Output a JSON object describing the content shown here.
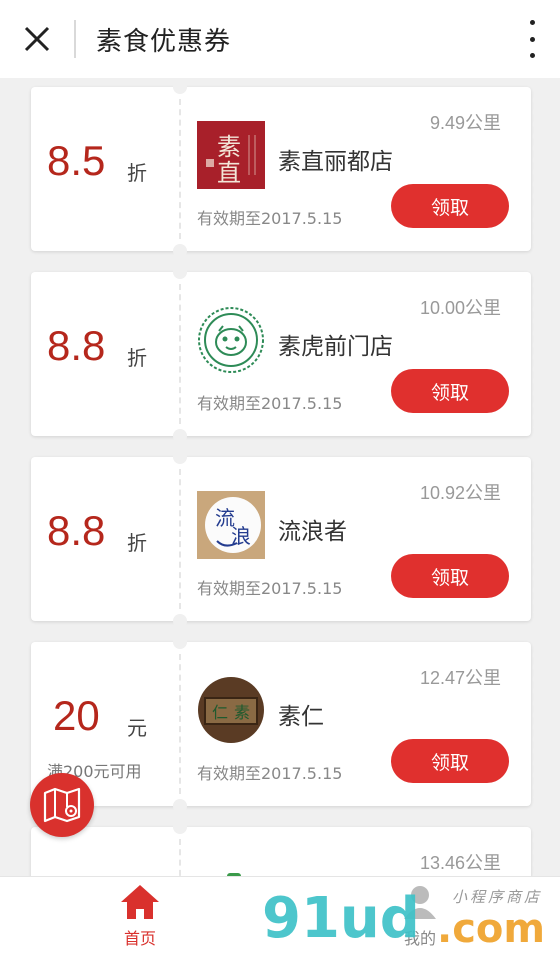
{
  "header": {
    "title": "素食优惠券"
  },
  "coupons": [
    {
      "value": "8.5",
      "unit": "折",
      "condition": "",
      "store": "素直丽都店",
      "distance": "9.49公里",
      "validity": "有效期至2017.5.15",
      "button": "领取",
      "logo_text": "素直",
      "logo_icon": "suzhi-logo"
    },
    {
      "value": "8.8",
      "unit": "折",
      "condition": "",
      "store": "素虎前门店",
      "distance": "10.00公里",
      "validity": "有效期至2017.5.15",
      "button": "领取",
      "logo_text": "",
      "logo_icon": "suhu-tiger-logo"
    },
    {
      "value": "8.8",
      "unit": "折",
      "condition": "",
      "store": "流浪者",
      "distance": "10.92公里",
      "validity": "有效期至2017.5.15",
      "button": "领取",
      "logo_text": "流浪",
      "logo_icon": "liulangzhe-logo"
    },
    {
      "value": "20",
      "unit": "元",
      "condition": "满200元可用",
      "store": "素仁",
      "distance": "12.47公里",
      "validity": "有效期至2017.5.15",
      "button": "领取",
      "logo_text": "仁素",
      "logo_icon": "suren-plaque-logo"
    },
    {
      "value": "",
      "unit": "",
      "condition": "",
      "store": "",
      "distance": "13.46公里",
      "validity": "",
      "button": "",
      "logo_text": "",
      "logo_icon": ""
    }
  ],
  "nav": {
    "home_label": "首页",
    "mine_label": "我的"
  },
  "watermark": {
    "main": "91ud",
    "suffix": ".com",
    "sub": "小程序商店"
  },
  "colors": {
    "accent": "#e0302e",
    "value_red": "#b5271c",
    "watermark_teal": "#3ec2c8",
    "watermark_orange": "#f0a531"
  },
  "icons": {
    "close": "close-icon",
    "more": "more-vertical-icon",
    "map": "map-pin-icon",
    "home": "home-icon",
    "user": "user-icon"
  }
}
